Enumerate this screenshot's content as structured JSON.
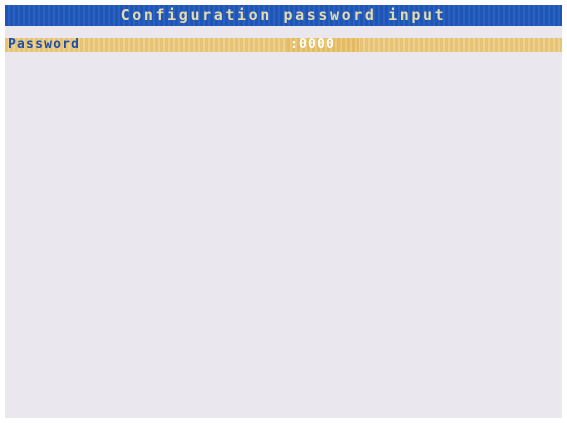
{
  "header": {
    "title": "Configuration password input"
  },
  "fields": {
    "password": {
      "label": "Password",
      "value": ":0000"
    }
  },
  "colors": {
    "title_bar": "#1f55b4",
    "title_text": "#e6dbad",
    "row_highlight": "#e7c377",
    "label_text": "#1d4fa8",
    "value_text": "#ffffff",
    "screen_background": "#ebe7ef"
  }
}
